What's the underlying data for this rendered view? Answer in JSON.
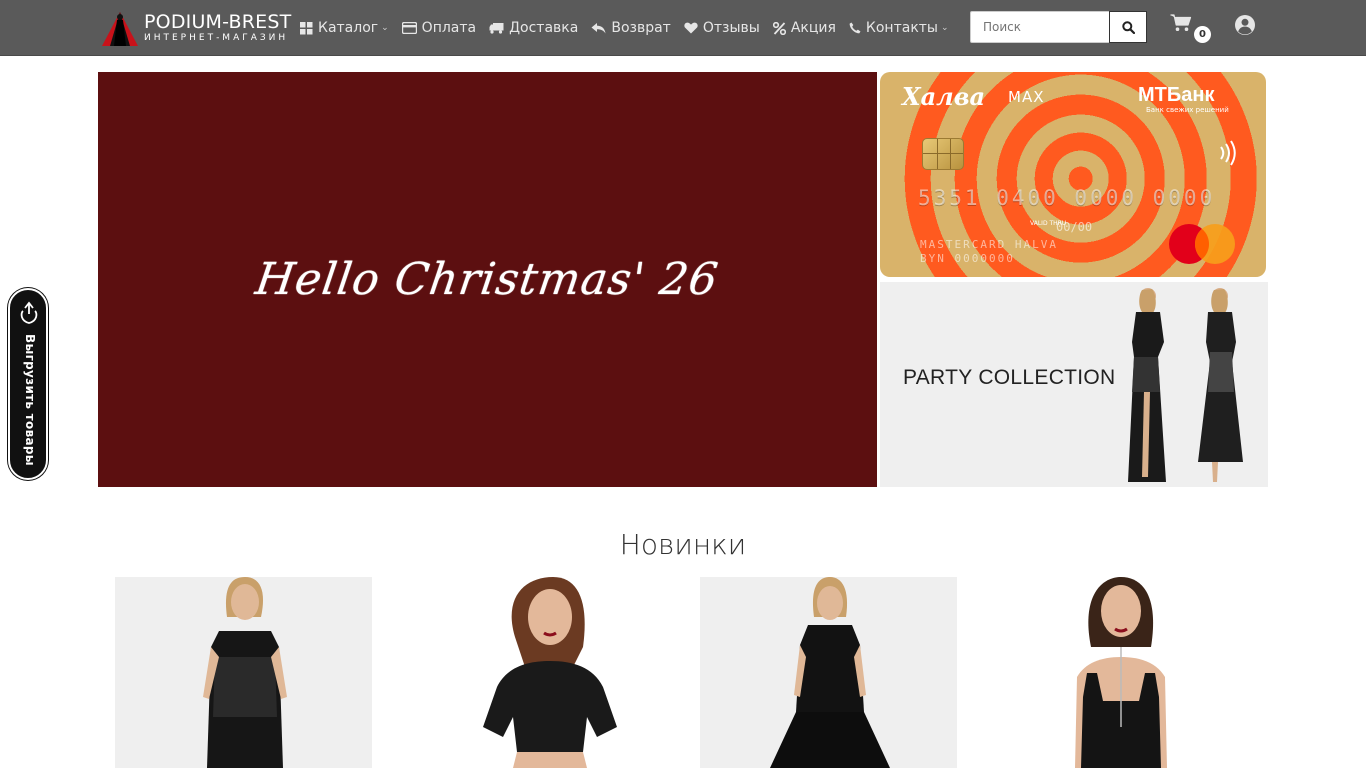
{
  "brand": {
    "title": "PODIUM-BREST",
    "subtitle": "ИНТЕРНЕТ-МАГАЗИН"
  },
  "nav": {
    "items": [
      {
        "label": "Каталог",
        "icon": "grid-icon",
        "has_dropdown": true
      },
      {
        "label": "Оплата",
        "icon": "credit-card-icon",
        "has_dropdown": false
      },
      {
        "label": "Доставка",
        "icon": "truck-icon",
        "has_dropdown": false
      },
      {
        "label": "Возврат",
        "icon": "reply-icon",
        "has_dropdown": false
      },
      {
        "label": "Отзывы",
        "icon": "heart-icon",
        "has_dropdown": false
      },
      {
        "label": "Акция",
        "icon": "percent-icon",
        "has_dropdown": false
      },
      {
        "label": "Контакты",
        "icon": "phone-icon",
        "has_dropdown": true
      }
    ]
  },
  "search": {
    "placeholder": "Поиск",
    "icon": "search-icon"
  },
  "cart": {
    "count": "0",
    "icon": "cart-icon"
  },
  "user": {
    "icon": "user-circle-icon"
  },
  "hero": {
    "main_text": "Hello Christmas' 26",
    "main_bg": "#5c0f10"
  },
  "promo_card": {
    "brand": "Халва",
    "brand_suffix": "MAX",
    "bank": "МТБанк",
    "bank_tagline": "Банк свежих решений",
    "number": "5351 0400 0000 0000",
    "valid_label": "VALID THRU",
    "valid_date": "00/00",
    "cardholder_line1": "MASTERCARD HALVA",
    "cardholder_line2": "BYN 0000000",
    "accent": "#ff5a1f",
    "gold": "#d9b36a"
  },
  "party_banner": {
    "title": "PARTY COLLECTION"
  },
  "side_tab": {
    "label": "Выгрузить товары",
    "icon": "export-icon"
  },
  "section": {
    "title": "Новинки"
  },
  "products": [
    {
      "name": "black-sequin-dress"
    },
    {
      "name": "black-mesh-top"
    },
    {
      "name": "black-sleeveless-top"
    },
    {
      "name": "black-velvet-top"
    }
  ],
  "colors": {
    "navbar": "#5a5a5a",
    "nav_text": "#e6e6e6"
  }
}
